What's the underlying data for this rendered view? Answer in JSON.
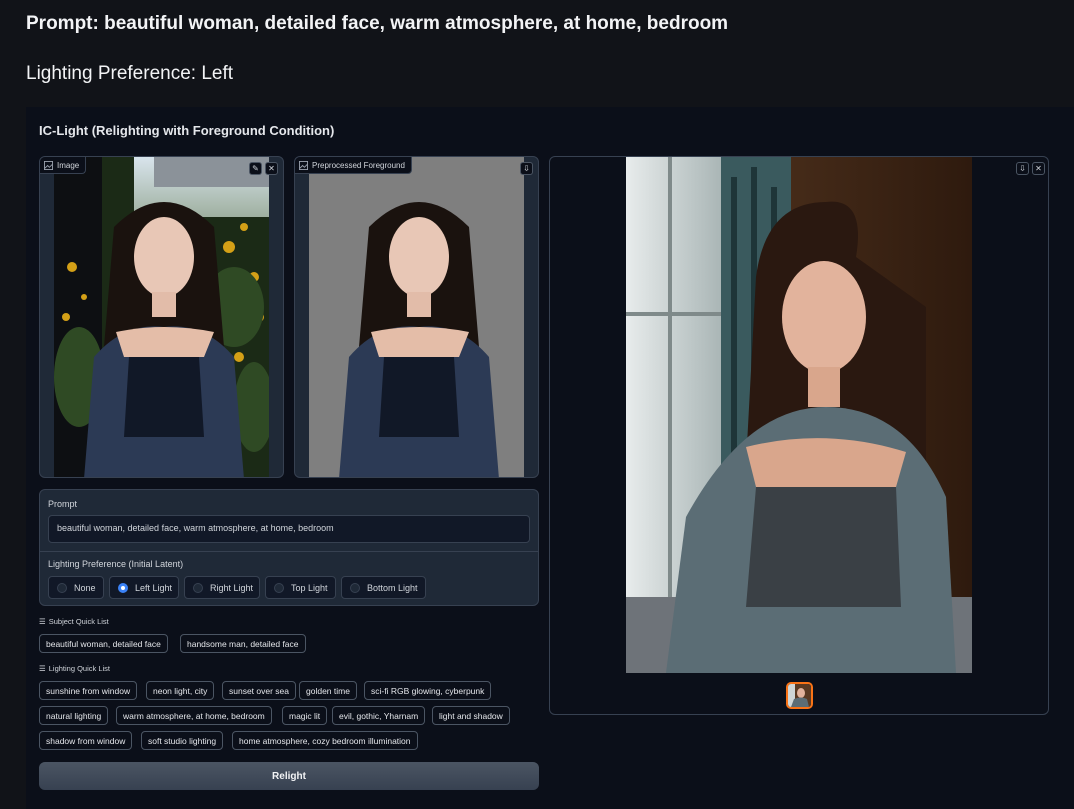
{
  "header": {
    "prompt_line": "Prompt: beautiful woman, detailed face, warm atmosphere, at home, bedroom",
    "lighting_line": "Lighting Preference: Left"
  },
  "app": {
    "title": "IC-Light (Relighting with Foreground Condition)"
  },
  "image_panel": {
    "label": "Image",
    "icon": "image-icon",
    "buttons": [
      "edit-icon",
      "close-icon"
    ]
  },
  "foreground_panel": {
    "label": "Preprocessed Foreground",
    "icon": "image-icon",
    "buttons": [
      "download-icon"
    ]
  },
  "form": {
    "prompt_label": "Prompt",
    "prompt_value": "beautiful woman, detailed face, warm atmosphere, at home, bedroom",
    "lighting_label": "Lighting Preference (Initial Latent)",
    "lighting_options": [
      "None",
      "Left Light",
      "Right Light",
      "Top Light",
      "Bottom Light"
    ],
    "lighting_selected": "Left Light"
  },
  "subject_quick_list": {
    "label": "Subject Quick List",
    "items": [
      "beautiful woman, detailed face",
      "handsome man, detailed face"
    ]
  },
  "lighting_quick_list": {
    "label": "Lighting Quick List",
    "items": [
      "sunshine from window",
      "neon light, city",
      "sunset over sea",
      "golden time",
      "sci-fi RGB glowing, cyberpunk",
      "natural lighting",
      "warm atmosphere, at home, bedroom",
      "magic lit",
      "evil, gothic, Yharnam",
      "light and shadow",
      "shadow from window",
      "soft studio lighting",
      "home atmosphere, cozy bedroom illumination"
    ]
  },
  "relight_button": "Relight",
  "output_gallery": {
    "buttons": [
      "download-icon",
      "close-icon"
    ]
  },
  "colors": {
    "accent": "#3b82f6",
    "thumb_border": "#f97316",
    "background": "#0b0f19"
  }
}
